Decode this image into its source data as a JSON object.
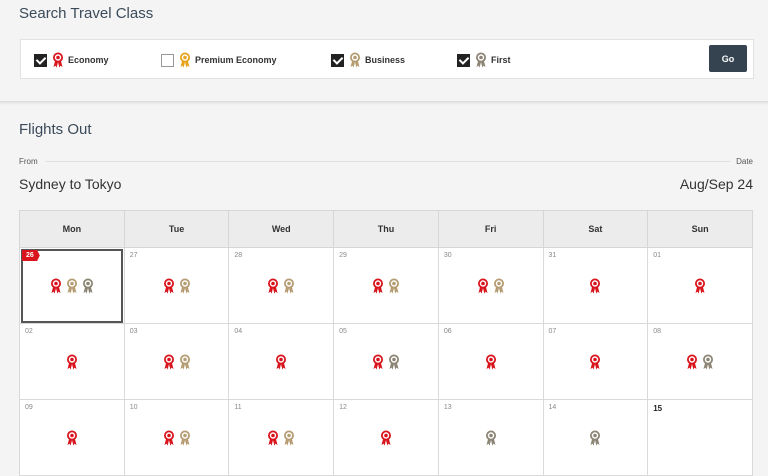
{
  "search": {
    "title": "Search Travel Class",
    "options": [
      {
        "label": "Economy",
        "checked": true,
        "icon": "award-icon-red"
      },
      {
        "label": "Premium Economy",
        "checked": false,
        "icon": "award-icon-orange"
      },
      {
        "label": "Business",
        "checked": true,
        "icon": "award-icon-tan"
      },
      {
        "label": "First",
        "checked": true,
        "icon": "award-icon-gray"
      }
    ],
    "go_label": "Go"
  },
  "flights": {
    "title": "Flights Out",
    "from_label": "From",
    "date_label": "Date",
    "route": "Sydney to Tokyo",
    "month": "Aug/Sep 24",
    "weekdays": [
      "Mon",
      "Tue",
      "Wed",
      "Thu",
      "Fri",
      "Sat",
      "Sun"
    ],
    "weeks": [
      [
        {
          "day": "26",
          "awards": [
            "economy",
            "business",
            "first"
          ],
          "selected": true
        },
        {
          "day": "27",
          "awards": [
            "economy",
            "business"
          ]
        },
        {
          "day": "28",
          "awards": [
            "economy",
            "business"
          ]
        },
        {
          "day": "29",
          "awards": [
            "economy",
            "business"
          ]
        },
        {
          "day": "30",
          "awards": [
            "economy",
            "business"
          ]
        },
        {
          "day": "31",
          "awards": [
            "economy"
          ]
        },
        {
          "day": "01",
          "awards": [
            "economy"
          ]
        }
      ],
      [
        {
          "day": "02",
          "awards": [
            "economy"
          ]
        },
        {
          "day": "03",
          "awards": [
            "economy",
            "business"
          ]
        },
        {
          "day": "04",
          "awards": [
            "economy"
          ]
        },
        {
          "day": "05",
          "awards": [
            "economy",
            "first"
          ]
        },
        {
          "day": "06",
          "awards": [
            "economy"
          ]
        },
        {
          "day": "07",
          "awards": [
            "economy"
          ]
        },
        {
          "day": "08",
          "awards": [
            "economy",
            "first"
          ]
        }
      ],
      [
        {
          "day": "09",
          "awards": [
            "economy"
          ]
        },
        {
          "day": "10",
          "awards": [
            "economy",
            "business"
          ]
        },
        {
          "day": "11",
          "awards": [
            "economy",
            "business"
          ]
        },
        {
          "day": "12",
          "awards": [
            "economy"
          ]
        },
        {
          "day": "13",
          "awards": [
            "first"
          ]
        },
        {
          "day": "14",
          "awards": [
            "first"
          ]
        },
        {
          "day": "15",
          "awards": [],
          "today": true
        }
      ]
    ]
  },
  "colors": {
    "economy": "#d9141c",
    "premium": "#e8a21c",
    "business": "#b59c72",
    "first": "#8c8575",
    "go_button": "#34434f"
  }
}
